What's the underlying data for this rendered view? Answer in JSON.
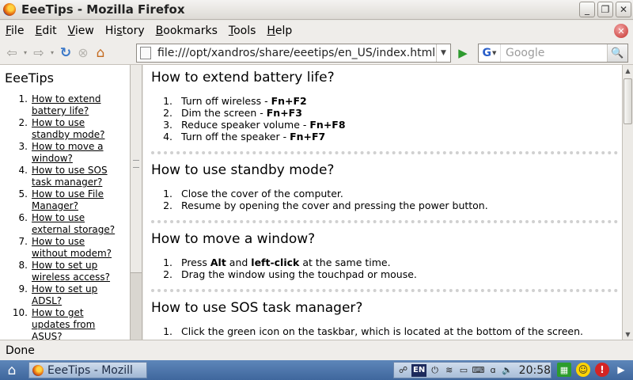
{
  "window": {
    "title": "EeeTips - Mozilla Firefox"
  },
  "menu": [
    "File",
    "Edit",
    "View",
    "History",
    "Bookmarks",
    "Tools",
    "Help"
  ],
  "menu_mnemonics": [
    "F",
    "E",
    "V",
    "s",
    "B",
    "T",
    "H"
  ],
  "nav": {
    "url": "file:///opt/xandros/share/eeetips/en_US/index.html",
    "search_placeholder": "Google"
  },
  "sidebar": {
    "title": "EeeTips",
    "items": [
      {
        "num": "1.",
        "label": "How to extend battery life?"
      },
      {
        "num": "2.",
        "label": "How to use standby mode?"
      },
      {
        "num": "3.",
        "label": "How to move a window?"
      },
      {
        "num": "4.",
        "label": "How to use SOS task manager?"
      },
      {
        "num": "5.",
        "label": "How to use File Manager?"
      },
      {
        "num": "6.",
        "label": "How to use external storage?"
      },
      {
        "num": "7.",
        "label": "How to use without modem?"
      },
      {
        "num": "8.",
        "label": "How to set up wireless access?"
      },
      {
        "num": "9.",
        "label": "How to set up ADSL?"
      },
      {
        "num": "10.",
        "label": "How to get updates from ASUS?"
      }
    ]
  },
  "content": {
    "sections": [
      {
        "title": "How to extend battery life?",
        "steps": [
          {
            "num": "1.",
            "text": "Turn off wireless - ",
            "key": "Fn+F2"
          },
          {
            "num": "2.",
            "text": "Dim the screen - ",
            "key": "Fn+F3"
          },
          {
            "num": "3.",
            "text": "Reduce speaker volume - ",
            "key": "Fn+F8"
          },
          {
            "num": "4.",
            "text": "Turn off the speaker - ",
            "key": "Fn+F7"
          }
        ]
      },
      {
        "title": "How to use standby mode?",
        "steps": [
          {
            "num": "1.",
            "text": "Close the cover of the computer."
          },
          {
            "num": "2.",
            "text": "Resume by opening the cover and pressing the power button."
          }
        ]
      },
      {
        "title": "How to move a window?",
        "steps": [
          {
            "num": "1.",
            "pre": "Press ",
            "b1": "Alt",
            "mid": " and ",
            "b2": "left-click",
            "post": " at the same time."
          },
          {
            "num": "2.",
            "text": "Drag the window using the touchpad or mouse."
          }
        ]
      },
      {
        "title": "How to use SOS task manager?",
        "steps": [
          {
            "num": "1.",
            "text": "Click the green icon on the taskbar, which is located at the bottom of the screen."
          }
        ]
      }
    ]
  },
  "status": "Done",
  "taskbar": {
    "task_label": "EeeTips - Mozill",
    "lang": "EN",
    "clock": "20:58"
  },
  "colors": {
    "taskbar": "#4f77ab",
    "link": "#000000",
    "dash": "#d0d0d0"
  }
}
